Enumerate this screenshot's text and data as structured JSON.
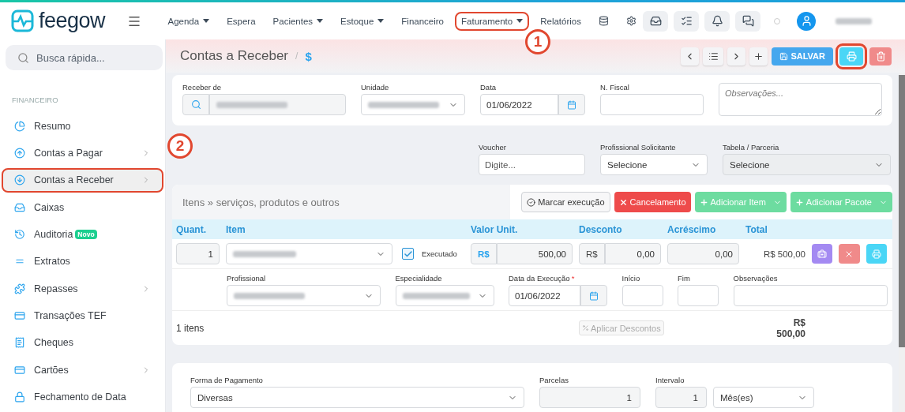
{
  "header": {
    "logo": "feegow",
    "nav": [
      {
        "label": "Agenda",
        "dropdown": true,
        "highlighted": false
      },
      {
        "label": "Espera",
        "dropdown": false,
        "highlighted": false
      },
      {
        "label": "Pacientes",
        "dropdown": true,
        "highlighted": false
      },
      {
        "label": "Estoque",
        "dropdown": true,
        "highlighted": false
      },
      {
        "label": "Financeiro",
        "dropdown": false,
        "highlighted": false
      },
      {
        "label": "Faturamento",
        "dropdown": true,
        "highlighted": true
      },
      {
        "label": "Relatórios",
        "dropdown": false,
        "highlighted": false
      }
    ]
  },
  "search": {
    "placeholder": "Busca rápida..."
  },
  "sidebar": {
    "section": "FINANCEIRO",
    "items": [
      {
        "label": "Resumo",
        "submenu": false,
        "selected": false,
        "highlighted": false
      },
      {
        "label": "Contas a Pagar",
        "submenu": true,
        "selected": false,
        "highlighted": false
      },
      {
        "label": "Contas a Receber",
        "submenu": true,
        "selected": true,
        "highlighted": true
      },
      {
        "label": "Caixas",
        "submenu": false,
        "selected": false,
        "highlighted": false
      },
      {
        "label": "Auditoria",
        "badge": "Novo",
        "submenu": false,
        "selected": false,
        "highlighted": false
      },
      {
        "label": "Extratos",
        "submenu": false,
        "selected": false,
        "highlighted": false
      },
      {
        "label": "Repasses",
        "submenu": true,
        "selected": false,
        "highlighted": false
      },
      {
        "label": "Transações TEF",
        "submenu": false,
        "selected": false,
        "highlighted": false
      },
      {
        "label": "Cheques",
        "submenu": false,
        "selected": false,
        "highlighted": false
      },
      {
        "label": "Cartões",
        "submenu": true,
        "selected": false,
        "highlighted": false
      },
      {
        "label": "Fechamento de Data",
        "submenu": false,
        "selected": false,
        "highlighted": false
      }
    ]
  },
  "page": {
    "title": "Contas a Receber",
    "separator": "/",
    "breadcrumb": "$"
  },
  "toolbar": {
    "save": "SALVAR",
    "print_highlighted": true
  },
  "annotations": [
    {
      "label": "1"
    },
    {
      "label": "2"
    }
  ],
  "account": {
    "fields": [
      {
        "label": "Receber de",
        "kind": "search",
        "redacted": true
      },
      {
        "label": "Unidade",
        "kind": "select",
        "redacted": true
      },
      {
        "label": "Data",
        "kind": "date",
        "value": "01/06/2022"
      },
      {
        "label": "N. Fiscal",
        "kind": "input"
      },
      {
        "kind": "textarea",
        "placeholder": "Observações..."
      }
    ]
  },
  "extra": {
    "fields": [
      {
        "label": "Voucher",
        "kind": "input",
        "placeholder": "Digite..."
      },
      {
        "label": "Profissional Solicitante",
        "kind": "select",
        "value": "Selecione",
        "disabled": false
      },
      {
        "label": "Tabela / Parceria",
        "kind": "select",
        "value": "Selecione",
        "disabled": true
      }
    ]
  },
  "items": {
    "title": "Itens » serviços, produtos e outros",
    "actions": [
      {
        "label": "Marcar execução",
        "kind": "outline",
        "dropdown": false
      },
      {
        "label": "Cancelamento",
        "kind": "danger",
        "dropdown": false
      },
      {
        "label": "Adicionar Item",
        "kind": "success",
        "dropdown": true
      },
      {
        "label": "Adicionar Pacote",
        "kind": "success",
        "dropdown": true
      }
    ],
    "columns": [
      "Quant.",
      "Item",
      "Valor Unit.",
      "Desconto",
      "Acréscimo",
      "Total"
    ],
    "rows": [
      {
        "quantity": "1",
        "executed": true,
        "executed_label": "Executado",
        "unit_currency": "R$",
        "unit_value": "500,00",
        "discount_currency": "R$",
        "discount": "0,00",
        "surcharge": "0,00",
        "total": "R$ 500,00",
        "details": [
          {
            "label": "Profissional",
            "kind": "select",
            "redacted": true
          },
          {
            "label": "Especialidade",
            "kind": "select",
            "redacted": true
          },
          {
            "label": "Data da Execução",
            "kind": "date",
            "value": "01/06/2022",
            "required_mark": "*"
          },
          {
            "label": "Início",
            "kind": "input"
          },
          {
            "label": "Fim",
            "kind": "input"
          },
          {
            "label": "Observações",
            "kind": "input"
          }
        ]
      }
    ],
    "footer": {
      "count": "1 itens",
      "apply": "Aplicar Descontos",
      "apply_disabled": true,
      "total_currency": "R$",
      "total": "500,00"
    }
  },
  "payment": {
    "fields": [
      {
        "label": "Forma de Pagamento",
        "kind": "select",
        "value": "Diversas"
      },
      {
        "label": "Parcelas",
        "kind": "number",
        "value": "1"
      },
      {
        "label": "Intervalo",
        "kind": "number",
        "value": "1"
      },
      {
        "kind": "select",
        "value": "Mês(es)"
      }
    ]
  }
}
